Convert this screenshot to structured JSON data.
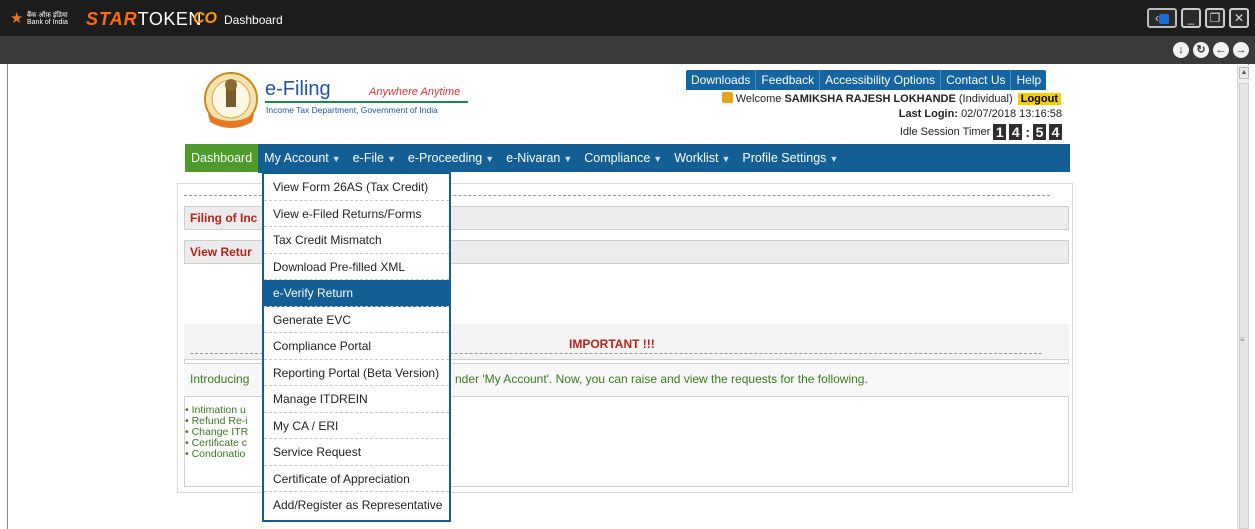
{
  "app": {
    "bank_name_hindi": "बैंक ऑफ़ इंडिया",
    "bank_name": "Bank of India",
    "brand_star": "STAR",
    "brand_token": "TOKEN",
    "window_title": "Dashboard",
    "icons": [
      "device-icon",
      "minimize-icon",
      "restore-icon",
      "close-icon",
      "download-icon",
      "refresh-icon",
      "back-icon",
      "forward-icon"
    ]
  },
  "site": {
    "title": "e-Filing",
    "tagline": "Anywhere Anytime",
    "subtitle": "Income Tax Department, Government of India",
    "top_links": [
      "Downloads",
      "Feedback",
      "Accessibility Options",
      "Contact Us",
      "Help"
    ],
    "welcome_prefix": "Welcome",
    "user_name": "SAMIKSHA RAJESH LOKHANDE",
    "user_type": "(Individual)",
    "logout_label": "Logout",
    "last_login_label": "Last Login:",
    "last_login_value": "02/07/2018 13:16:58",
    "idle_label": "Idle Session Timer",
    "timer_digits": [
      "1",
      "4",
      "5",
      "4"
    ]
  },
  "nav": {
    "items": [
      "Dashboard",
      "My Account",
      "e-File",
      "e-Proceeding",
      "e-Nivaran",
      "Compliance",
      "Worklist",
      "Profile Settings"
    ]
  },
  "dropdown": {
    "items": [
      "View Form 26AS (Tax Credit)",
      "View e-Filed Returns/Forms",
      "Tax Credit Mismatch",
      "Download Pre-filled XML",
      "e-Verify Return",
      "Generate EVC",
      "Compliance Portal",
      "Reporting Portal (Beta Version)",
      "Manage ITDREIN",
      "My CA / ERI",
      "Service Request",
      "Certificate of Appreciation",
      "Add/Register as Representative"
    ],
    "highlighted": "e-Verify Return"
  },
  "content": {
    "section1": "Filing of Inc",
    "section2": "View Retur",
    "important_title": "IMPORTANT !!!",
    "intro_left": "Introducing",
    "intro_right": "nder 'My Account'. Now, you can raise and view the requests for the following.",
    "bullets": [
      "Intimation u",
      "Refund Re-i",
      "Change ITR",
      "Certificate c",
      "Condonatio"
    ]
  },
  "colors": {
    "nav_blue": "#135e94",
    "active_green": "#4e9a2a",
    "alert_red": "#b3231b",
    "text_green": "#3b7a1f",
    "brand_orange": "#ff6a13"
  }
}
